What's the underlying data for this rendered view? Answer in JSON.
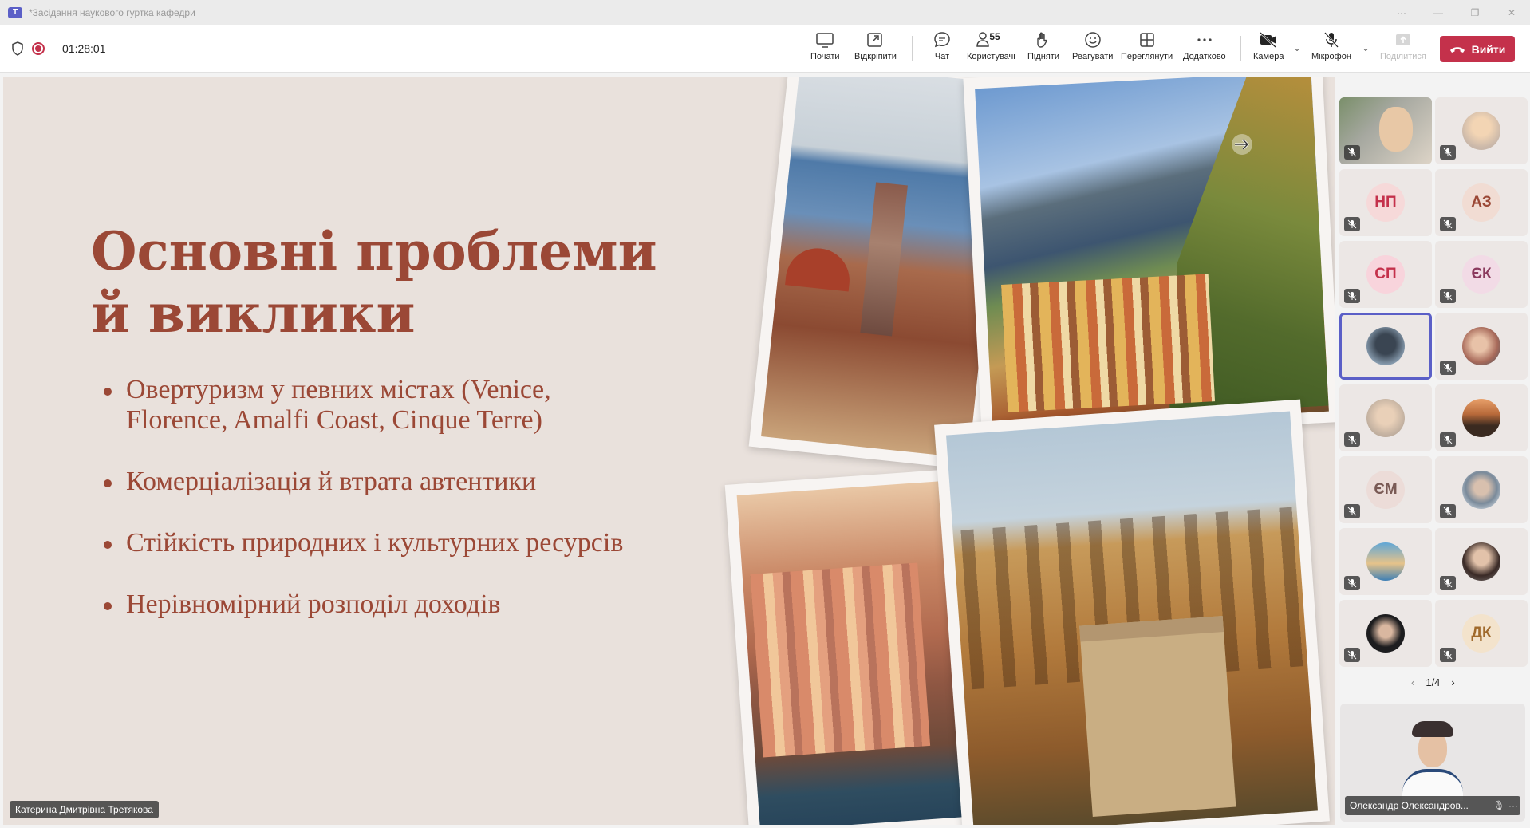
{
  "window": {
    "title": "*Засідання наукового гуртка кафедри"
  },
  "toolbar": {
    "timer": "01:28:01",
    "buttons": [
      {
        "id": "start",
        "label": "Почати",
        "icon": "present-icon"
      },
      {
        "id": "popout",
        "label": "Відкріпити",
        "icon": "popout-icon"
      },
      {
        "id": "chat",
        "label": "Чат",
        "icon": "chat-icon"
      },
      {
        "id": "people",
        "label": "Користувачі",
        "icon": "people-icon",
        "count": "55"
      },
      {
        "id": "raise",
        "label": "Підняти",
        "icon": "hand-icon"
      },
      {
        "id": "react",
        "label": "Реагувати",
        "icon": "emoji-icon"
      },
      {
        "id": "view",
        "label": "Переглянути",
        "icon": "grid-icon"
      },
      {
        "id": "more",
        "label": "Додатково",
        "icon": "more-icon"
      },
      {
        "id": "camera",
        "label": "Камера",
        "icon": "camera-off-icon"
      },
      {
        "id": "mic",
        "label": "Мікрофон",
        "icon": "mic-off-icon"
      },
      {
        "id": "share",
        "label": "Поділитися",
        "icon": "share-icon",
        "disabled": true
      }
    ],
    "leave_label": "Вийти"
  },
  "slide": {
    "title": "Основні проблеми й виклики",
    "bullets": [
      "Овертуризм у певних містах (Venice, Florence, Amalfi Coast, Cinque Terre)",
      "Комерціалізація й втрата автентики",
      "Стійкість природних і культурних ресурсів",
      "Нерівномірний розподіл доходів"
    ],
    "presenter": "Катерина Дмитрівна Третякова",
    "colors": {
      "text": "#9b4836",
      "background": "#e9e1dc"
    }
  },
  "participants": [
    {
      "initials": "",
      "kind": "video-woman-mountains"
    },
    {
      "initials": "",
      "kind": "photo-woman-light"
    },
    {
      "initials": "НП",
      "color": "#c4314b",
      "bg": "#f6d9d9"
    },
    {
      "initials": "АЗ",
      "color": "#9b4836",
      "bg": "#f1dcd3"
    },
    {
      "initials": "СП",
      "color": "#c4314b",
      "bg": "#f8d4dc"
    },
    {
      "initials": "ЄК",
      "color": "#8b3a5e",
      "bg": "#f2dbe6"
    },
    {
      "initials": "",
      "kind": "photo-man-dark",
      "active": true
    },
    {
      "initials": "",
      "kind": "photo-group"
    },
    {
      "initials": "",
      "kind": "photo-woman-blonde"
    },
    {
      "initials": "",
      "kind": "photo-sunset"
    },
    {
      "initials": "ЄМ",
      "color": "#7a5a55",
      "bg": "#ecdcd8"
    },
    {
      "initials": "",
      "kind": "photo-sunglasses"
    },
    {
      "initials": "",
      "kind": "photo-woman-sea"
    },
    {
      "initials": "",
      "kind": "photo-woman-dark"
    },
    {
      "initials": "",
      "kind": "photo-woman-black"
    },
    {
      "initials": "ДК",
      "color": "#a06a2c",
      "bg": "#f3e3cc"
    }
  ],
  "pager": {
    "text": "1/4"
  },
  "self_view": {
    "name": "Олександр Олександров..."
  }
}
